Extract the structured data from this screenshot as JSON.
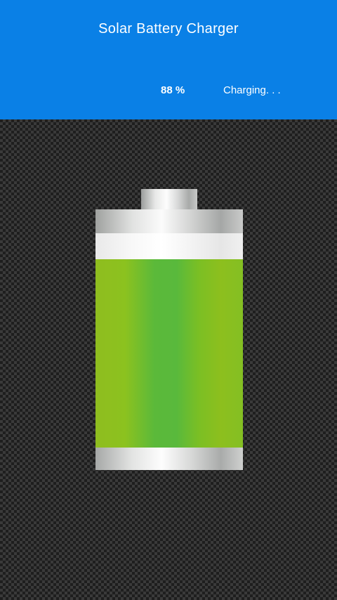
{
  "header": {
    "title": "Solar Battery Charger",
    "percent_text": "88 %",
    "status_text": "Charging. . ."
  },
  "battery": {
    "level_percent": 88,
    "fill_color": "#6fbe2c"
  },
  "colors": {
    "header_bg": "#0a80e6",
    "header_text": "#ffffff"
  }
}
